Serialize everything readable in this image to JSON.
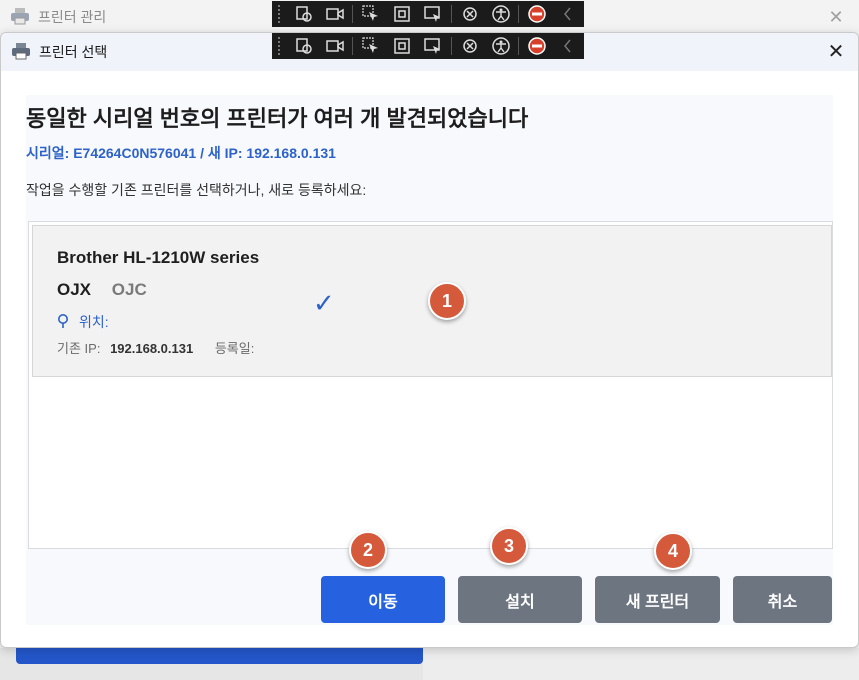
{
  "background_window": {
    "title": "프린터 관리"
  },
  "dialog": {
    "title": "프린터 선택",
    "heading": "동일한 시리얼 번호의 프린터가 여러 개 발견되었습니다",
    "serial_line": "시리얼: E74264C0N576041 / 새 IP: 192.168.0.131",
    "instruction": "작업을 수행할 기존 프린터를 선택하거나, 새로 등록하세요:",
    "printer": {
      "name": "Brother HL-1210W series",
      "code_primary": "OJX",
      "code_secondary": "OJC",
      "location_label": "위치:",
      "ip_label": "기존 IP:",
      "ip_value": "192.168.0.131",
      "registered_label": "등록일:",
      "selected_mark": "✓"
    },
    "buttons": {
      "move": "이동",
      "install": "설치",
      "new_printer": "새 프린터",
      "cancel": "취소"
    }
  },
  "badges": [
    "1",
    "2",
    "3",
    "4"
  ],
  "toolbar_icons": [
    "settings-icon",
    "video-icon",
    "select-icon",
    "stop-square-icon",
    "capture-icon",
    "sync-icon",
    "accessibility-icon",
    "block-icon",
    "collapse-icon"
  ],
  "colors": {
    "accent_blue": "#2662e0",
    "link_blue": "#2c62c9",
    "badge_orange": "#d5593b",
    "button_gray": "#6d7581"
  }
}
